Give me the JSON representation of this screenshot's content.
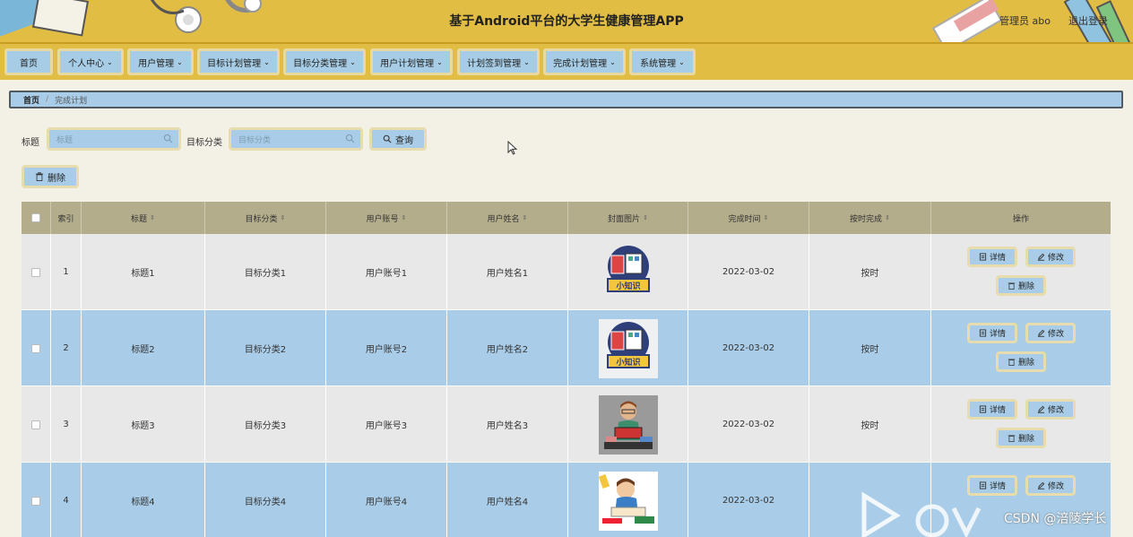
{
  "header": {
    "title": "基于Android平台的大学生健康管理APP",
    "user": "管理员 abo",
    "logout": "退出登录"
  },
  "nav": {
    "items": [
      {
        "label": "首页",
        "dropdown": false
      },
      {
        "label": "个人中心",
        "dropdown": true
      },
      {
        "label": "用户管理",
        "dropdown": true
      },
      {
        "label": "目标计划管理",
        "dropdown": true
      },
      {
        "label": "目标分类管理",
        "dropdown": true
      },
      {
        "label": "用户计划管理",
        "dropdown": true
      },
      {
        "label": "计划签到管理",
        "dropdown": true
      },
      {
        "label": "完成计划管理",
        "dropdown": true
      },
      {
        "label": "系统管理",
        "dropdown": true
      }
    ]
  },
  "breadcrumb": {
    "home": "首页",
    "separator": "/",
    "current": "完成计划"
  },
  "search": {
    "title_label": "标题",
    "title_placeholder": "标题",
    "category_label": "目标分类",
    "category_placeholder": "目标分类",
    "query_button": "查询"
  },
  "toolbar": {
    "delete_button": "删除"
  },
  "table": {
    "headers": [
      "索引",
      "标题",
      "目标分类",
      "用户账号",
      "用户姓名",
      "封面图片",
      "完成时间",
      "按时完成",
      "操作"
    ],
    "rows": [
      {
        "index": "1",
        "title": "标题1",
        "category": "目标分类1",
        "account": "用户账号1",
        "name": "用户姓名1",
        "image": "xiaozhishi",
        "time": "2022-03-02",
        "ontime": "按时"
      },
      {
        "index": "2",
        "title": "标题2",
        "category": "目标分类2",
        "account": "用户账号2",
        "name": "用户姓名2",
        "image": "xiaozhishi",
        "time": "2022-03-02",
        "ontime": "按时"
      },
      {
        "index": "3",
        "title": "标题3",
        "category": "目标分类3",
        "account": "用户账号3",
        "name": "用户姓名3",
        "image": "reader-man",
        "time": "2022-03-02",
        "ontime": "按时"
      },
      {
        "index": "4",
        "title": "标题4",
        "category": "目标分类4",
        "account": "用户账号4",
        "name": "用户姓名4",
        "image": "reader-boy",
        "time": "2022-03-02",
        "ontime": ""
      }
    ],
    "actions": {
      "detail": "详情",
      "edit": "修改",
      "delete": "删除"
    },
    "cover_text": "小知识"
  },
  "watermark": {
    "text": "CSDN @涪陵学长"
  },
  "colors": {
    "header_bg": "#e2bd44",
    "button_bg": "#a9cde8",
    "button_border": "#e7dcae",
    "table_head": "#b3ad8c",
    "row_even": "#a9cde8",
    "row_odd": "#e8e8e8"
  }
}
